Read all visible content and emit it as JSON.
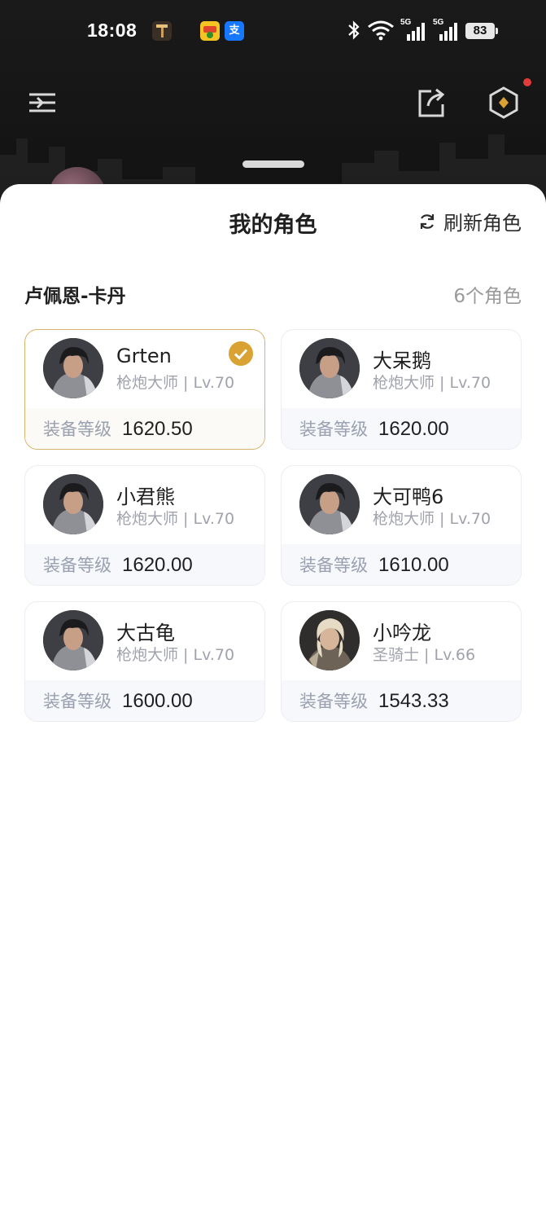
{
  "status_bar": {
    "time": "18:08",
    "battery": "83",
    "network_1": "5G",
    "network_2": "5G",
    "apps": [
      "app-icon-tools",
      "app-icon-cash",
      "alipay-icon"
    ],
    "alipay_glyph": "支"
  },
  "sheet": {
    "title": "我的角色",
    "refresh_label": "刷新角色",
    "server_name": "卢佩恩-卡丹",
    "character_count": "6个角色",
    "gear_label": "装备等级"
  },
  "characters": [
    {
      "name": "Grten",
      "info": "枪炮大师 | Lv.70",
      "gear": "1620.50",
      "selected": true,
      "portrait": "gunslinger"
    },
    {
      "name": "大呆鹅",
      "info": "枪炮大师 | Lv.70",
      "gear": "1620.00",
      "selected": false,
      "portrait": "gunslinger"
    },
    {
      "name": "小君熊",
      "info": "枪炮大师 | Lv.70",
      "gear": "1620.00",
      "selected": false,
      "portrait": "gunslinger"
    },
    {
      "name": "大可鸭6",
      "info": "枪炮大师 | Lv.70",
      "gear": "1610.00",
      "selected": false,
      "portrait": "gunslinger"
    },
    {
      "name": "大古龟",
      "info": "枪炮大师 | Lv.70",
      "gear": "1600.00",
      "selected": false,
      "portrait": "gunslinger"
    },
    {
      "name": "小吟龙",
      "info": "圣骑士 | Lv.66",
      "gear": "1543.33",
      "selected": false,
      "portrait": "paladin"
    }
  ],
  "colors": {
    "accent": "#d9a232",
    "selected_border": "#d6b46b",
    "muted_text": "#9aa0b0"
  }
}
